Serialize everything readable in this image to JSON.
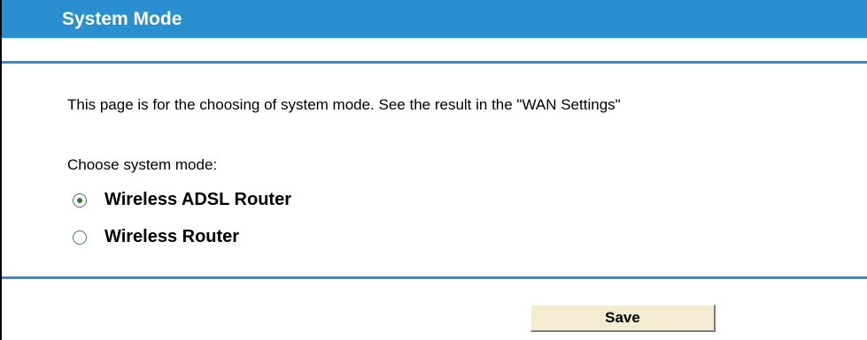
{
  "header": {
    "title": "System Mode"
  },
  "main": {
    "description": "This page is for the choosing of system mode. See the result in the \"WAN Settings\"",
    "choose_label": "Choose system mode:",
    "options": [
      {
        "label": "Wireless ADSL Router",
        "checked": true
      },
      {
        "label": "Wireless Router",
        "checked": false
      }
    ]
  },
  "footer": {
    "save_label": "Save"
  },
  "colors": {
    "accent": "#2a8fcf",
    "button_bg": "#f3ecd0"
  }
}
